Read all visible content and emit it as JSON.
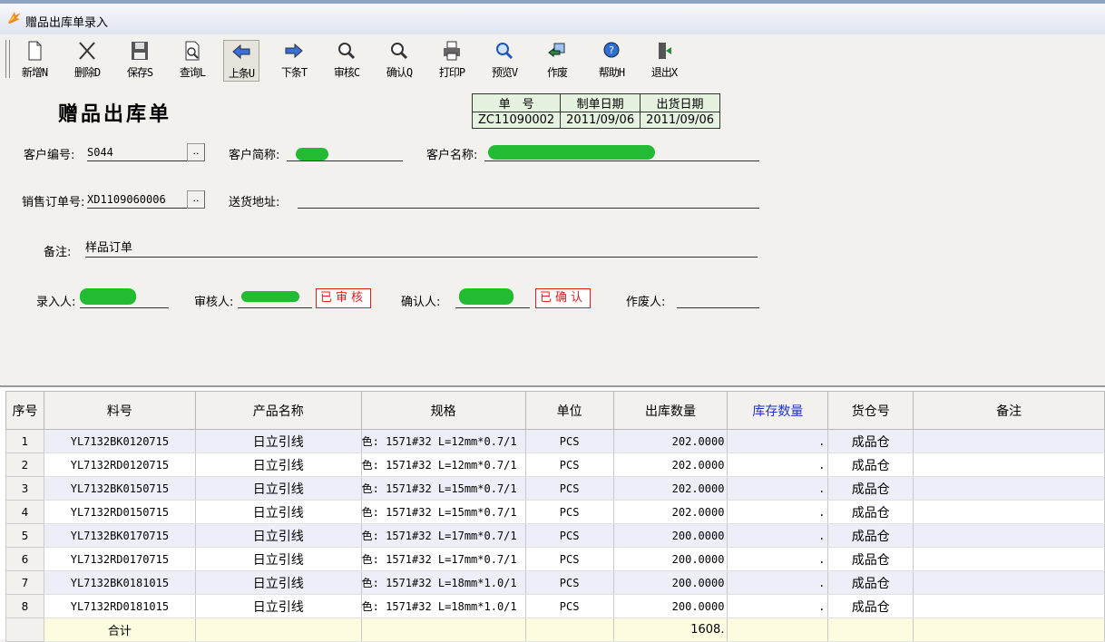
{
  "window": {
    "title": "赠品出库单录入"
  },
  "toolbar": [
    {
      "label": "新增N",
      "icon": "new-document-icon"
    },
    {
      "label": "删除D",
      "icon": "delete-x-icon"
    },
    {
      "label": "保存S",
      "icon": "save-disk-icon"
    },
    {
      "label": "查询L",
      "icon": "search-document-icon"
    },
    {
      "label": "上条U",
      "icon": "arrow-left-icon"
    },
    {
      "label": "下条T",
      "icon": "arrow-right-icon"
    },
    {
      "label": "审核C",
      "icon": "magnifier-icon"
    },
    {
      "label": "确认Q",
      "icon": "magnifier-icon"
    },
    {
      "label": "打印P",
      "icon": "printer-icon"
    },
    {
      "label": "预览V",
      "icon": "preview-magnifier-icon"
    },
    {
      "label": "作废",
      "icon": "void-arrow-icon"
    },
    {
      "label": "帮助H",
      "icon": "help-icon"
    },
    {
      "label": "退出X",
      "icon": "exit-door-icon"
    }
  ],
  "form": {
    "title": "赠品出库单",
    "header_table": {
      "headers": [
        "单　号",
        "制单日期",
        "出货日期"
      ],
      "values": [
        "ZC11090002",
        "2011/09/06",
        "2011/09/06"
      ]
    },
    "customer_code_label": "客户编号:",
    "customer_code": "S044",
    "customer_short_label": "客户简称:",
    "customer_name_label": "客户名称:",
    "sales_order_label": "销售订单号:",
    "sales_order": "XD1109060006",
    "address_label": "送货地址:",
    "address": "",
    "remark_label": "备注:",
    "remark": "样品订单",
    "entered_by_label": "录入人:",
    "reviewer_label": "审核人:",
    "reviewed_stamp": "已审核",
    "confirmer_label": "确认人:",
    "confirmed_stamp": "已确认",
    "voider_label": "作废人:",
    "voider": ""
  },
  "grid": {
    "columns": [
      "序号",
      "料号",
      "产品名称",
      "规格",
      "单位",
      "出库数量",
      "库存数量",
      "货仓号",
      "备注"
    ],
    "rows": [
      {
        "seq": "1",
        "part": "YL7132BK0120715",
        "name": "日立引线",
        "spec": "色: 1571#32 L=12mm*0.7/1",
        "unit": "PCS",
        "qty": "202.0000",
        "stock": ".",
        "warehouse": "成品仓",
        "remark": ""
      },
      {
        "seq": "2",
        "part": "YL7132RD0120715",
        "name": "日立引线",
        "spec": "色: 1571#32 L=12mm*0.7/1",
        "unit": "PCS",
        "qty": "202.0000",
        "stock": ".",
        "warehouse": "成品仓",
        "remark": ""
      },
      {
        "seq": "3",
        "part": "YL7132BK0150715",
        "name": "日立引线",
        "spec": "色: 1571#32 L=15mm*0.7/1",
        "unit": "PCS",
        "qty": "202.0000",
        "stock": ".",
        "warehouse": "成品仓",
        "remark": ""
      },
      {
        "seq": "4",
        "part": "YL7132RD0150715",
        "name": "日立引线",
        "spec": "色: 1571#32 L=15mm*0.7/1",
        "unit": "PCS",
        "qty": "202.0000",
        "stock": ".",
        "warehouse": "成品仓",
        "remark": ""
      },
      {
        "seq": "5",
        "part": "YL7132BK0170715",
        "name": "日立引线",
        "spec": "色: 1571#32 L=17mm*0.7/1",
        "unit": "PCS",
        "qty": "200.0000",
        "stock": ".",
        "warehouse": "成品仓",
        "remark": ""
      },
      {
        "seq": "6",
        "part": "YL7132RD0170715",
        "name": "日立引线",
        "spec": "色: 1571#32 L=17mm*0.7/1",
        "unit": "PCS",
        "qty": "200.0000",
        "stock": ".",
        "warehouse": "成品仓",
        "remark": ""
      },
      {
        "seq": "7",
        "part": "YL7132BK0181015",
        "name": "日立引线",
        "spec": "色: 1571#32 L=18mm*1.0/1",
        "unit": "PCS",
        "qty": "200.0000",
        "stock": ".",
        "warehouse": "成品仓",
        "remark": ""
      },
      {
        "seq": "8",
        "part": "YL7132RD0181015",
        "name": "日立引线",
        "spec": "色: 1571#32 L=18mm*1.0/1",
        "unit": "PCS",
        "qty": "200.0000",
        "stock": ".",
        "warehouse": "成品仓",
        "remark": ""
      }
    ],
    "total_label": "合计",
    "total_qty": "1608."
  },
  "colors": {
    "redacted": "#22bb33",
    "stamp": "#e02020",
    "stock_header": "#2233cc",
    "row_alt": "#eeeef8",
    "total_row": "#fdfbe0"
  }
}
